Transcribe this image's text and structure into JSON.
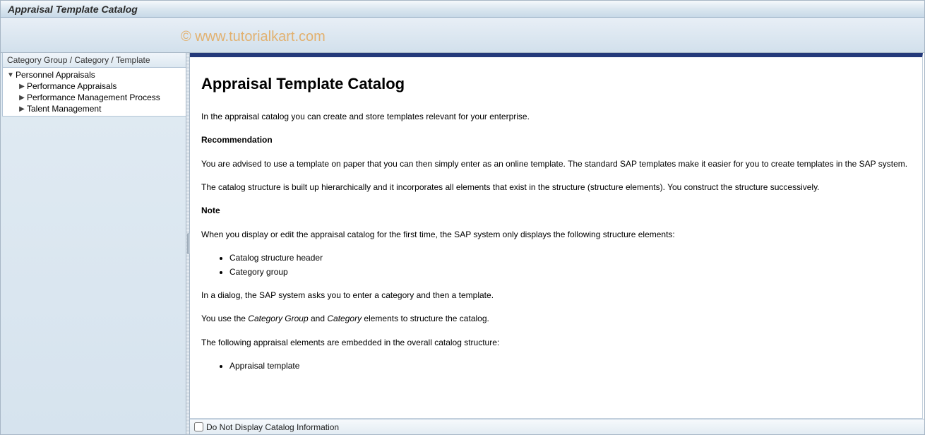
{
  "window": {
    "title": "Appraisal Template Catalog"
  },
  "watermark": "© www.tutorialkart.com",
  "tree": {
    "header": "Category Group / Category / Template",
    "root": {
      "label": "Personnel Appraisals",
      "expanded": true
    },
    "children": [
      {
        "label": "Performance Appraisals"
      },
      {
        "label": "Performance Management Process"
      },
      {
        "label": "Talent Management"
      }
    ]
  },
  "doc": {
    "heading": "Appraisal Template Catalog",
    "p_intro": "In the appraisal catalog you can create and store templates relevant for your enterprise.",
    "h_rec": "Recommendation",
    "p_rec": "You are advised to use a template on paper that you can then simply enter as an online template. The standard SAP templates make it easier for you to create templates in the SAP system.",
    "p_struct": "The catalog structure is built up hierarchically and it incorporates all elements that exist in the structure (structure elements). You construct the structure successively.",
    "h_note": "Note",
    "p_note": "When you display or edit the appraisal catalog for the first time, the SAP system only displays the following structure elements:",
    "list1": [
      "Catalog structure header",
      "Category group"
    ],
    "p_dialog": "In a dialog, the SAP system asks you to enter a category and then a template.",
    "p_use_pre": "You use the ",
    "p_use_em1": "Category Group",
    "p_use_mid": " and ",
    "p_use_em2": "Category",
    "p_use_post": " elements to structure the catalog.",
    "p_embed": "The following appraisal elements are embedded in the overall catalog structure:",
    "list2": [
      "Appraisal template"
    ]
  },
  "footer": {
    "checkbox_label": "Do Not Display Catalog Information",
    "checked": false
  }
}
